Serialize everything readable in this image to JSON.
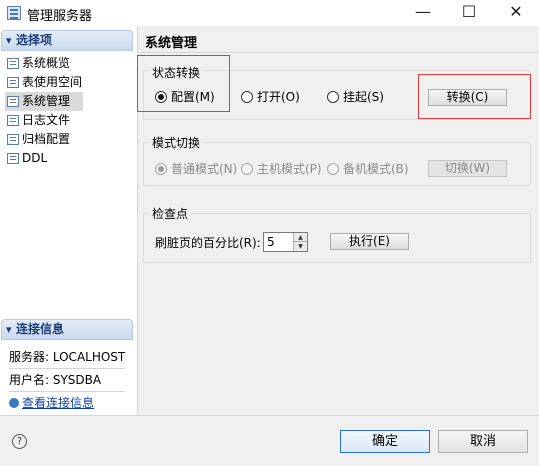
{
  "window": {
    "title": "管理服务器",
    "min_symbol": "—",
    "max_symbol": "☐",
    "close_symbol": "✕"
  },
  "sidebar": {
    "section_title": "选择项",
    "items": [
      {
        "label": "系统概览",
        "icon": "document-icon"
      },
      {
        "label": "表使用空间",
        "icon": "document-icon"
      },
      {
        "label": "系统管理",
        "icon": "document-icon",
        "selected": true
      },
      {
        "label": "日志文件",
        "icon": "document-icon"
      },
      {
        "label": "归档配置",
        "icon": "document-icon"
      },
      {
        "label": "DDL",
        "icon": "document-icon"
      }
    ],
    "connection_title": "连接信息",
    "server_label": "服务器: LOCALHOST",
    "user_label": "用户名: SYSDBA",
    "view_link": "查看连接信息"
  },
  "main": {
    "title": "系统管理",
    "state_group": {
      "label": "状态转换",
      "options": [
        {
          "label": "配置(M)",
          "checked": true
        },
        {
          "label": "打开(O)",
          "checked": false
        },
        {
          "label": "挂起(S)",
          "checked": false
        }
      ],
      "button": "转换(C)"
    },
    "mode_group": {
      "label": "模式切换",
      "options": [
        {
          "label": "普通模式(N)",
          "checked": true
        },
        {
          "label": "主机模式(P)",
          "checked": false
        },
        {
          "label": "备机模式(B)",
          "checked": false
        }
      ],
      "button": "切换(W)"
    },
    "checkpoint_group": {
      "label": "检查点",
      "field_label": "刷脏页的百分比(R):",
      "field_value": "5",
      "button": "执行(E)"
    }
  },
  "footer": {
    "help": "?",
    "ok": "确定",
    "cancel": "取消"
  },
  "colors": {
    "highlight_border": "#e23b3b",
    "section_header_text": "#1b3e78",
    "link": "#0a3fa8"
  }
}
